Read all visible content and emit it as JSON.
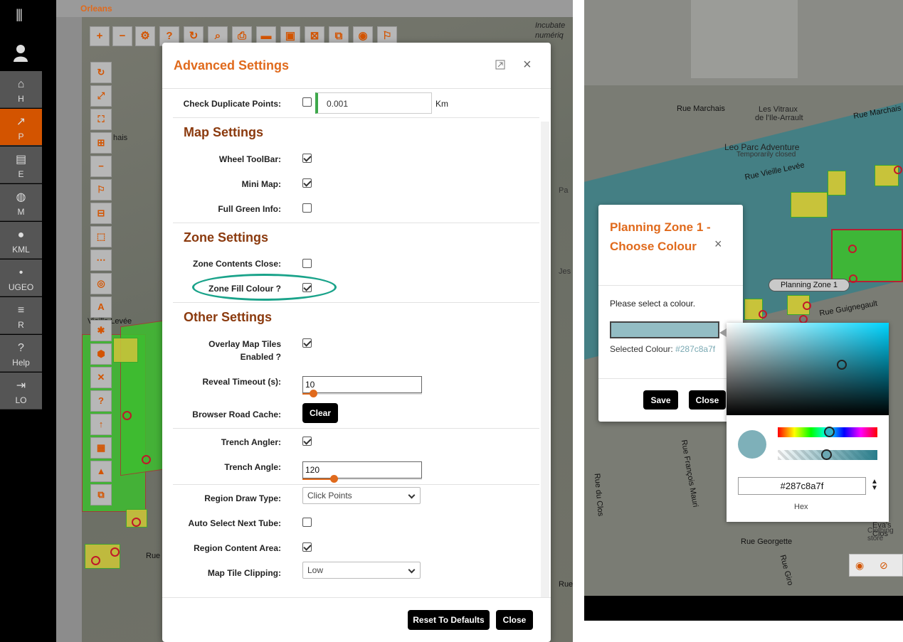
{
  "nav": {
    "items": [
      {
        "icon": "home-icon",
        "glyph": "⌂",
        "label": "H"
      },
      {
        "icon": "share-icon",
        "glyph": "↗",
        "label": "P"
      },
      {
        "icon": "chip-icon",
        "glyph": "▤",
        "label": "E"
      },
      {
        "icon": "globe-icon",
        "glyph": "◍",
        "label": "M"
      },
      {
        "icon": "pin-icon",
        "glyph": "●",
        "label": "KML"
      },
      {
        "icon": "pushpin-icon",
        "glyph": "•",
        "label": "UGEO"
      },
      {
        "icon": "list-icon",
        "glyph": "≡",
        "label": "R"
      },
      {
        "icon": "question-icon",
        "glyph": "?",
        "label": "Help"
      },
      {
        "icon": "logout-icon",
        "glyph": "⇥",
        "label": "LO"
      }
    ]
  },
  "map_left": {
    "city": "Orleans",
    "labels": {
      "chais": "hais",
      "vieille": "Vieille Levée",
      "rue1": "Rue",
      "rue2": "Rue",
      "incubate": "Incubate",
      "numeriq": "numériq",
      "pa": "Pa",
      "jes": "Jes",
      "rue3": "Rue"
    },
    "toolbar": [
      "+",
      "−",
      "⚙",
      "?",
      "↻",
      "⌕",
      "⎙",
      "▬",
      "▣",
      "⊠",
      "⧉",
      "◉",
      "⚐"
    ],
    "vertical_tools": [
      "↻",
      "⤢",
      "⛶",
      "⊞",
      "−",
      "⚐",
      "⊟",
      "⬚",
      "⋯",
      "◎",
      "A",
      "✱",
      "⬢",
      "✕",
      "?",
      "↑",
      "▦",
      "▲",
      "⧉"
    ]
  },
  "dialog": {
    "title": "Advanced Settings",
    "check_duplicate": {
      "label": "Check Duplicate Points:",
      "value": "0.001",
      "unit": "Km"
    },
    "map_settings": {
      "heading": "Map Settings",
      "wheel_toolbar": "Wheel ToolBar:",
      "mini_map": "Mini Map:",
      "full_green": "Full Green Info:"
    },
    "zone_settings": {
      "heading": "Zone Settings",
      "zone_contents_close": "Zone Contents Close:",
      "zone_fill_colour": "Zone Fill Colour ?"
    },
    "other_settings": {
      "heading": "Other Settings",
      "overlay_line1": "Overlay Map Tiles",
      "overlay_line2": "Enabled ?",
      "reveal_timeout": "Reveal Timeout (s):",
      "reveal_value": "10",
      "reveal_level": 0.09,
      "road_cache": "Browser Road Cache:",
      "clear": "Clear",
      "trench_angler": "Trench Angler:",
      "trench_angle": "Trench Angle:",
      "trench_value": "120",
      "trench_level": 0.26,
      "region_draw_type": "Region Draw Type:",
      "region_draw_value": "Click Points",
      "auto_select": "Auto Select Next Tube:",
      "region_content": "Region Content Area:",
      "tile_clipping": "Map Tile Clipping:",
      "tile_clipping_value": "Low"
    },
    "reset": "Reset To Defaults",
    "close": "Close"
  },
  "map_right": {
    "labels": {
      "marchais": "Rue Marchais",
      "vitraux": "Les Vitraux",
      "arrault": "de l'Ile-Arrault",
      "marchais2": "Rue Marchais",
      "leo": "Leo Parc Adventure",
      "closed": "Temporarily closed",
      "vieille": "Rue Vieille Levée",
      "guignegault": "Rue Guignegault",
      "francois": "Rue François Mauri",
      "clos": "Rue du Clos",
      "georgette": "Rue Georgette",
      "girou": "Rue Giro",
      "evas": "Eva's Clos",
      "clothing": "Clothing store"
    },
    "zone_pill": "Planning Zone 1"
  },
  "colour_dialog": {
    "title": "Planning Zone 1 - Choose Colour",
    "message": "Please select a colour.",
    "selected_label": "Selected Colour:",
    "selected_value": "#287c8a7f",
    "save": "Save",
    "close": "Close"
  },
  "picker": {
    "hex": "#287c8a7f",
    "hex_label": "Hex"
  },
  "colors": {
    "accent": "#e06a1c",
    "section": "#8b3a0e",
    "highlight": "#1aa38a",
    "zone": "#287c8a"
  }
}
